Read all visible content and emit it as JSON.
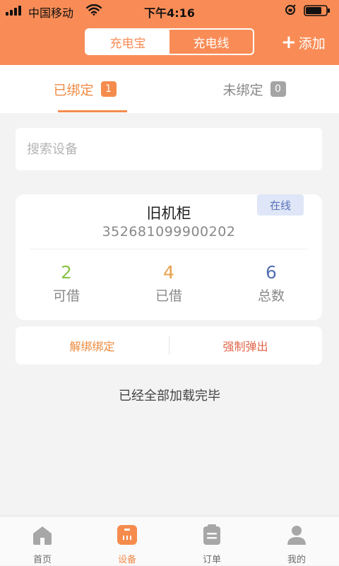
{
  "status_bar": {
    "carrier": "中国移动",
    "time": "下午4:16"
  },
  "header": {
    "segments": [
      "充电宝",
      "充电线"
    ],
    "selected_segment": "充电宝",
    "add_label": "添加"
  },
  "tabs": {
    "bound_label": "已绑定",
    "bound_count": "1",
    "unbound_label": "未绑定",
    "unbound_count": "0"
  },
  "search": {
    "placeholder": "搜索设备"
  },
  "device": {
    "status": "在线",
    "name": "旧机柜",
    "id": "352681099900202",
    "stats": [
      {
        "value": "2",
        "label": "可借",
        "color": "#8bc34a"
      },
      {
        "value": "4",
        "label": "已借",
        "color": "#e8a04a"
      },
      {
        "value": "6",
        "label": "总数",
        "color": "#5671b3"
      }
    ],
    "actions": {
      "unbind": "解绑绑定",
      "eject": "强制弹出"
    }
  },
  "list_end_text": "已经全部加载完毕",
  "bottom_nav": {
    "items": [
      {
        "label": "首页",
        "icon": "home-icon"
      },
      {
        "label": "设备",
        "icon": "device-icon"
      },
      {
        "label": "订单",
        "icon": "order-icon"
      },
      {
        "label": "我的",
        "icon": "user-icon"
      }
    ],
    "active": "设备"
  },
  "colors": {
    "accent": "#f98c56",
    "active_nav": "#f08a45",
    "online_badge_bg": "#dfe6f7",
    "online_badge_text": "#5a73b8"
  }
}
